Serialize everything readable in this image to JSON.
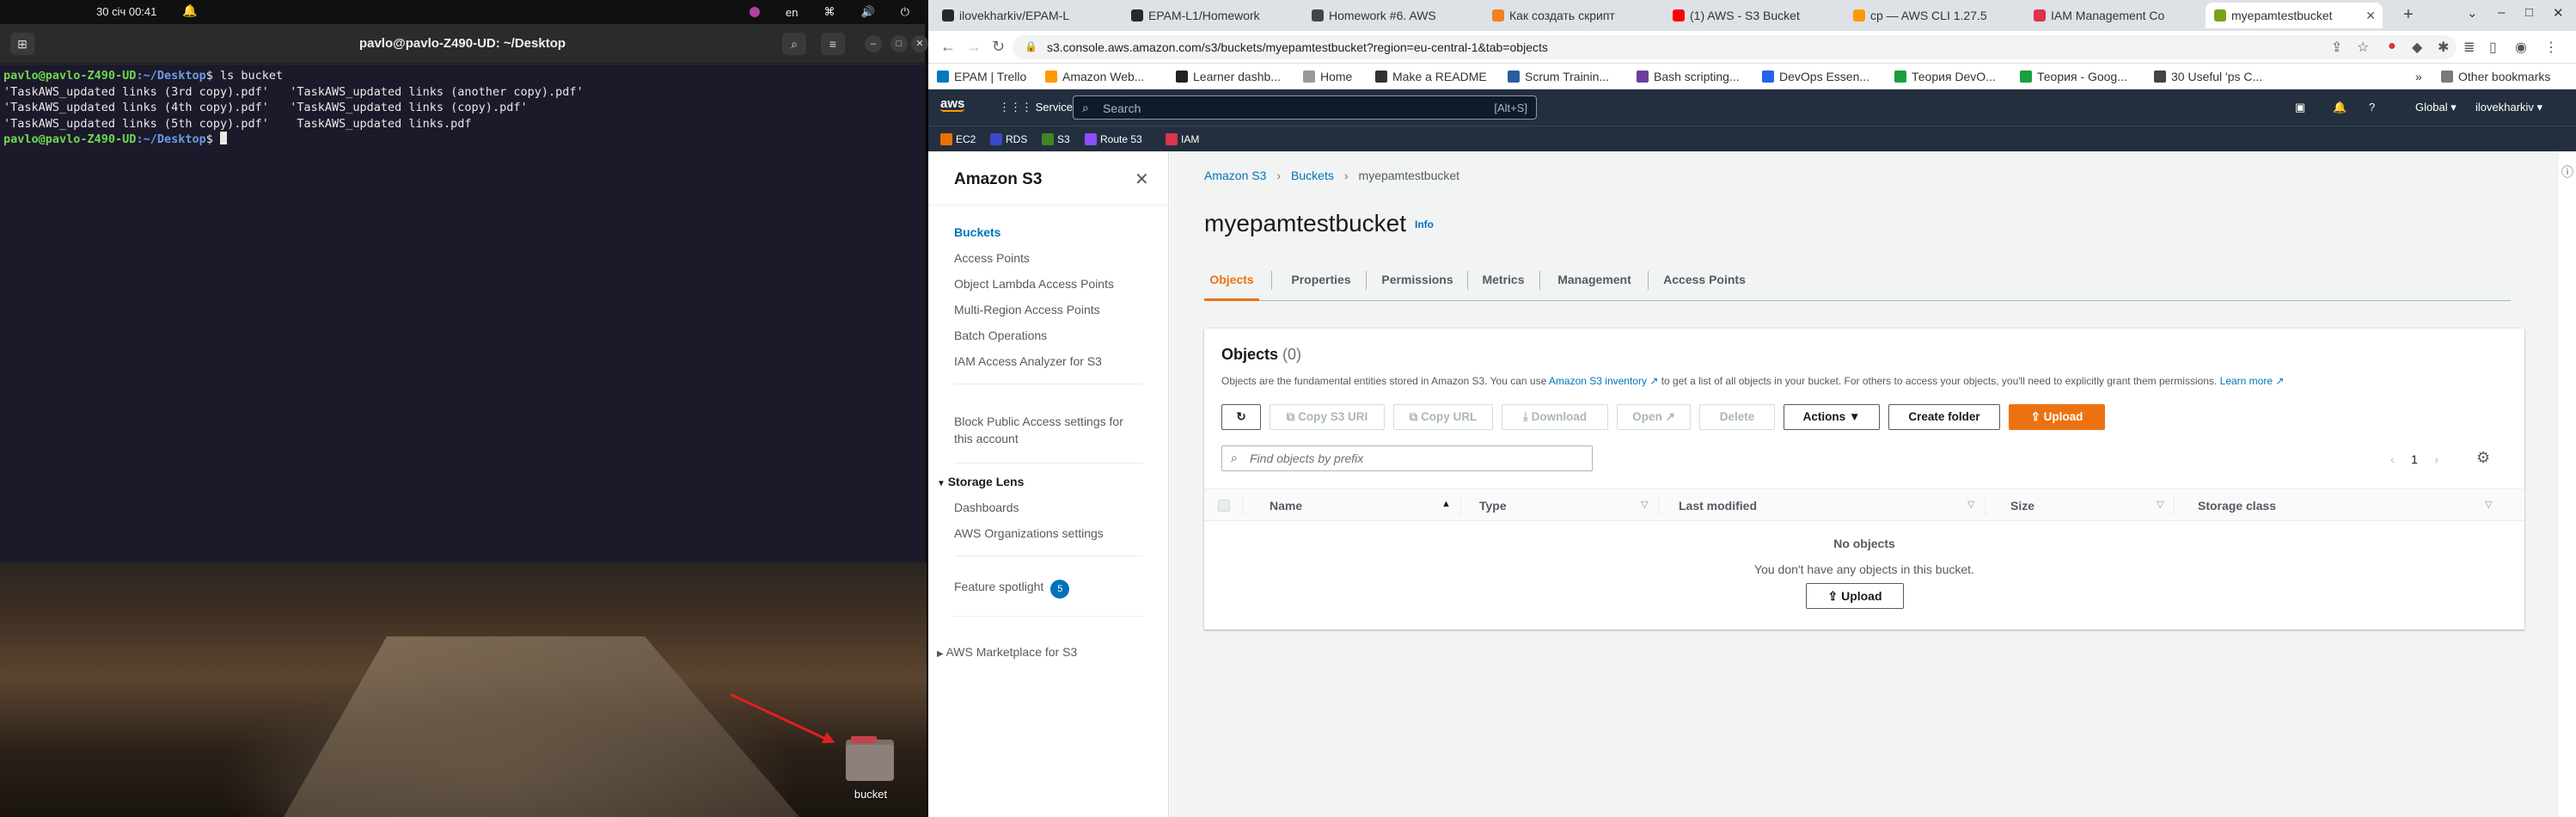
{
  "topbar": {
    "clock": "30 січ  00:41",
    "lang": "en"
  },
  "terminal": {
    "title": "pavlo@pavlo-Z490-UD: ~/Desktop",
    "prompt_user": "pavlo@pavlo-Z490-UD",
    "prompt_path": ":~/Desktop",
    "prompt_symbol": "$",
    "command": " ls bucket",
    "output": [
      "'TaskAWS_updated links (3rd copy).pdf'   'TaskAWS_updated links (another copy).pdf'",
      "'TaskAWS_updated links (4th copy).pdf'   'TaskAWS_updated links (copy).pdf'",
      "'TaskAWS_updated links (5th copy).pdf'    TaskAWS_updated links.pdf"
    ]
  },
  "desktop": {
    "folder_label": "bucket"
  },
  "browser": {
    "tabs": [
      {
        "label": "ilovekharkiv/EPAM-L",
        "color": "#24292f"
      },
      {
        "label": "EPAM-L1/Homework",
        "color": "#24292f"
      },
      {
        "label": "Homework #6. AWS",
        "color": "#444444"
      },
      {
        "label": "Как создать скрипт",
        "color": "#f48024"
      },
      {
        "label": "(1) AWS - S3 Bucket",
        "color": "#ff0000"
      },
      {
        "label": "cp — AWS CLI 1.27.5",
        "color": "#ff9900"
      },
      {
        "label": "IAM Management Co",
        "color": "#dd344c"
      },
      {
        "label": "myepamtestbucket",
        "color": "#7aa116"
      }
    ],
    "url": "s3.console.aws.amazon.com/s3/buckets/myepamtestbucket?region=eu-central-1&tab=objects",
    "bookmarks": [
      {
        "label": "EPAM | Trello",
        "color": "#0079bf"
      },
      {
        "label": "Amazon Web...",
        "color": "#ff9900"
      },
      {
        "label": "Learner dashb...",
        "color": "#222222"
      },
      {
        "label": "Home",
        "color": "#999999"
      },
      {
        "label": "Make a README",
        "color": "#333333"
      },
      {
        "label": "Scrum Trainin...",
        "color": "#2d5c9c"
      },
      {
        "label": "Bash scripting...",
        "color": "#6b3fa0"
      },
      {
        "label": "DevOps Essen...",
        "color": "#2463eb"
      },
      {
        "label": "Теория DevO...",
        "color": "#1a9e3f"
      },
      {
        "label": "Теория - Goog...",
        "color": "#1a9e3f"
      },
      {
        "label": "30 Useful 'ps C...",
        "color": "#444444"
      }
    ],
    "other_bookmarks": "Other bookmarks"
  },
  "aws": {
    "services": "Services",
    "search_placeholder": "Search",
    "search_shortcut": "[Alt+S]",
    "region": "Global",
    "account": "ilovekharkiv",
    "favorites": [
      {
        "label": "EC2",
        "color": "#ed7100"
      },
      {
        "label": "RDS",
        "color": "#3b48cc"
      },
      {
        "label": "S3",
        "color": "#3f8624"
      },
      {
        "label": "Route 53",
        "color": "#8c4fff"
      },
      {
        "label": "IAM",
        "color": "#dd344c"
      }
    ]
  },
  "sidebar": {
    "title": "Amazon S3",
    "links": [
      {
        "label": "Buckets",
        "active": true
      },
      {
        "label": "Access Points"
      },
      {
        "label": "Object Lambda Access Points"
      },
      {
        "label": "Multi-Region Access Points"
      },
      {
        "label": "Batch Operations"
      },
      {
        "label": "IAM Access Analyzer for S3"
      }
    ],
    "block_public_1": "Block Public Access settings for",
    "block_public_2": "this account",
    "storage_lens": "Storage Lens",
    "storage_lens_links": [
      "Dashboards",
      "AWS Organizations settings"
    ],
    "feature_spotlight": "Feature spotlight",
    "feature_spotlight_count": "5",
    "marketplace": "AWS Marketplace for S3"
  },
  "main": {
    "breadcrumb": [
      "Amazon S3",
      "Buckets",
      "myepamtestbucket"
    ],
    "title": "myepamtestbucket",
    "info": "Info",
    "tabs": [
      "Objects",
      "Properties",
      "Permissions",
      "Metrics",
      "Management",
      "Access Points"
    ],
    "objects": {
      "heading": "Objects",
      "count": "(0)",
      "desc_1": "Objects are the fundamental entities stored in Amazon S3. You can use ",
      "desc_link": "Amazon S3 inventory",
      "desc_2": " to get a list of all objects in your bucket. For others to access your objects, you'll need to explicitly grant them permissions. ",
      "learn_more": "Learn more",
      "buttons": {
        "copy_uri": "Copy S3 URI",
        "copy_url": "Copy URL",
        "download": "Download",
        "open": "Open",
        "delete": "Delete",
        "actions": "Actions",
        "create_folder": "Create folder",
        "upload": "Upload"
      },
      "find_placeholder": "Find objects by prefix",
      "page": "1",
      "columns": [
        "Name",
        "Type",
        "Last modified",
        "Size",
        "Storage class"
      ],
      "empty_title": "No objects",
      "empty_desc": "You don't have any objects in this bucket.",
      "empty_upload": "Upload"
    }
  }
}
